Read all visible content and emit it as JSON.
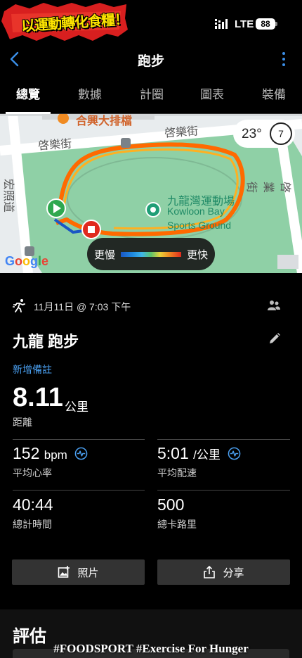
{
  "status_bar": {
    "sticker_text": "以運動轉化食糧！",
    "network": "LTE",
    "battery": "88"
  },
  "header": {
    "title": "跑步"
  },
  "tabs": [
    "總覽",
    "數據",
    "計圈",
    "圖表",
    "裝備"
  ],
  "map": {
    "streets": [
      "啓樂街",
      "啓樂街",
      "宏照道",
      "啓業街"
    ],
    "poi_top": "合興大排檔",
    "poi_name_zh": "九龍灣運動場",
    "poi_name_en_1": "Kowloon Bay",
    "poi_name_en_2": "Sports Ground",
    "weather_temp": "23°",
    "weather_wind": "7",
    "legend_slow": "更慢",
    "legend_fast": "更快",
    "google": "Google"
  },
  "activity": {
    "date": "11月11日 @ 7:03 下午",
    "name": "九龍 跑步",
    "add_note": "新增備註",
    "distance": "8.11",
    "distance_unit": "公里",
    "distance_label": "距離"
  },
  "stats": {
    "avg_hr": "152",
    "avg_hr_unit": "bpm",
    "avg_hr_label": "平均心率",
    "avg_pace": "5:01",
    "avg_pace_unit": "/公里",
    "avg_pace_label": "平均配速",
    "total_time": "40:44",
    "total_time_label": "總計時間",
    "calories": "500",
    "calories_label": "總卡路里"
  },
  "buttons": {
    "photos": "照片",
    "share": "分享"
  },
  "assessment": {
    "title": "評估"
  },
  "watermark": "#FOODSPORT #Exercise For Hunger"
}
